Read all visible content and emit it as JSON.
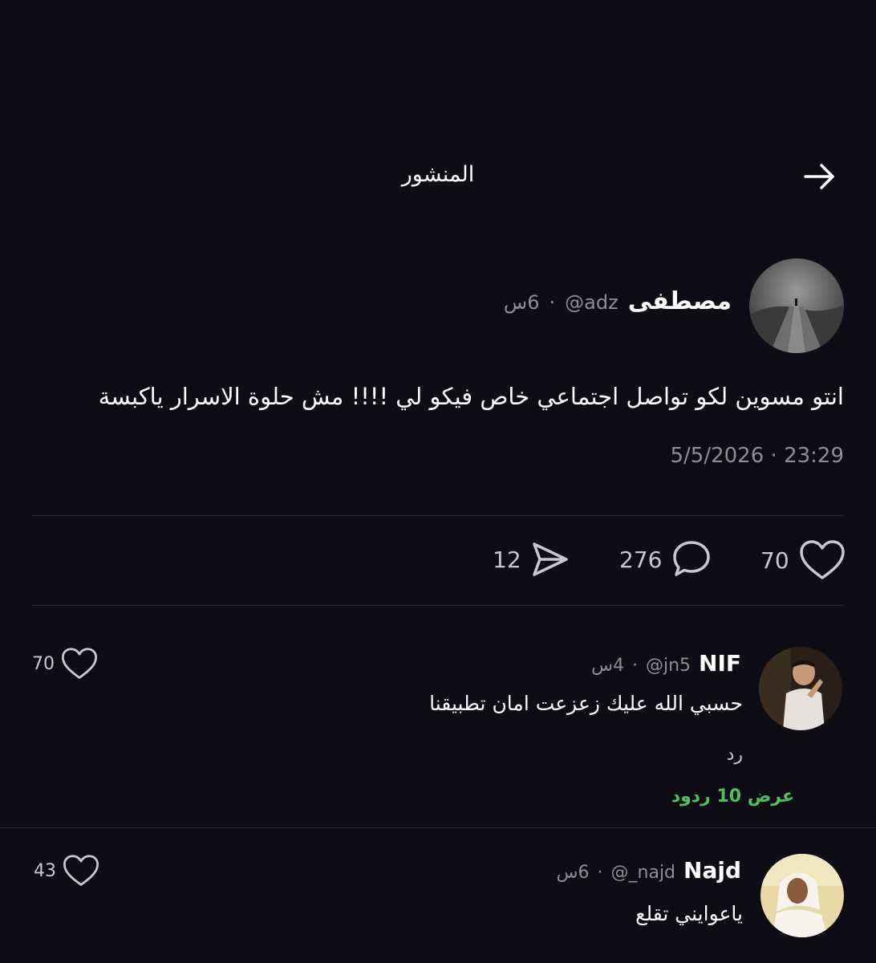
{
  "header": {
    "title": "المنشور",
    "back_icon": "arrow-right-icon"
  },
  "post": {
    "author_name": "مصطفى",
    "handle": "@adz",
    "separator": "·",
    "age": "6س",
    "body": "انتو مسوين لكو تواصل اجتماعي خاص فيكو لي !!!! مش حلوة الاسرار ياكبسة",
    "date": "5/5/2026",
    "time": "23:29",
    "likes": "70",
    "comments": "276",
    "shares": "12"
  },
  "comments": [
    {
      "name": "NIF",
      "handle": "@jn5",
      "age": "4س",
      "body": "حسبي الله عليك زعزعت امان تطبيقنا",
      "reply_label": "رد",
      "view_replies": "عرض 10 ردود",
      "likes": "70"
    },
    {
      "name": "Najd",
      "handle": "@_najd",
      "age": "6س",
      "body": "ياعوايني تقلع",
      "likes": "43"
    }
  ],
  "colors": {
    "background": "#0e0d15",
    "muted": "#8e8c95",
    "accent_green": "#4fbf5e",
    "divider": "#2a2933"
  }
}
